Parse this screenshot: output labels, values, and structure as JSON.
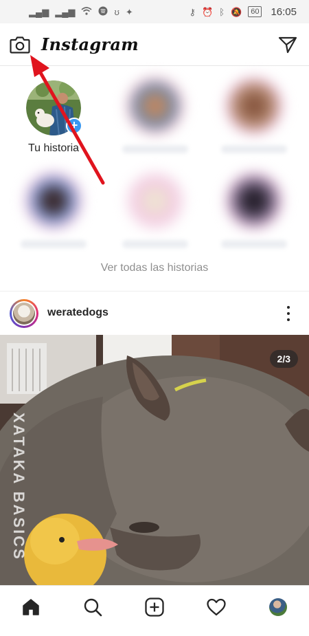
{
  "status_bar": {
    "time": "16:05",
    "battery": "60",
    "icons": [
      "signal-icon",
      "signal-icon",
      "wifi-icon",
      "spotify-icon",
      "wifi-tether-icon",
      "gps-icon",
      "key-icon",
      "alarm-icon",
      "bluetooth-icon",
      "mute-icon",
      "battery-icon"
    ]
  },
  "appbar": {
    "brand": "Instagram",
    "camera_icon": "camera-icon",
    "dm_icon": "direct-message-icon"
  },
  "stories": {
    "own_label": "Tu historia",
    "see_all": "Ver todas las historias"
  },
  "post": {
    "username": "weratedogs",
    "counter": "2/3",
    "watermark": "XATAKA BASICS"
  },
  "bottom_nav": {
    "items": [
      "home-icon",
      "search-icon",
      "new-post-icon",
      "activity-icon",
      "profile-icon"
    ]
  },
  "colors": {
    "accent_blue": "#3897f0",
    "annotation_red": "#e0141e"
  }
}
